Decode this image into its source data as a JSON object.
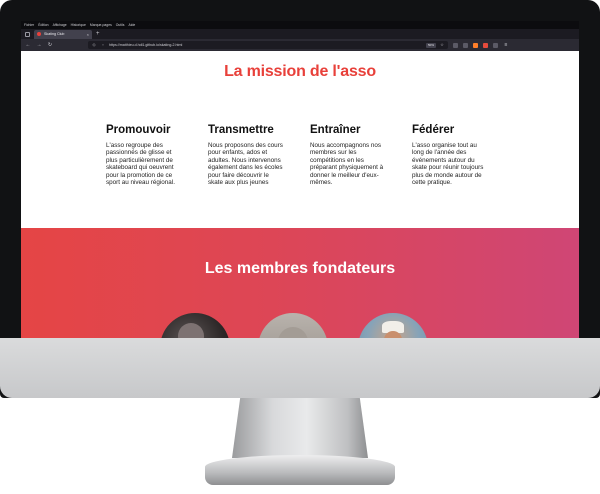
{
  "browser": {
    "menu": [
      "Fichier",
      "Édition",
      "Affichage",
      "Historique",
      "Marque-pages",
      "Outils",
      "Aide"
    ],
    "tab_title": "Skating Club",
    "tab_close": "×",
    "new_tab": "+",
    "url": "https://matthieu.d.hdi1.github.io/skating-2.html",
    "url_badge": "50%"
  },
  "mission": {
    "title": "La mission de l'asso",
    "items": [
      {
        "heading": "Promouvoir",
        "text": "L'asso regroupe des passionnés de glisse et plus particulièrement de skateboard qui oeuvrent pour la promotion de ce sport au niveau régional."
      },
      {
        "heading": "Transmettre",
        "text": "Nous proposons des cours pour enfants, ados et adultes. Nous intervenons également dans les écoles pour faire découvrir le skate aux plus jeunes"
      },
      {
        "heading": "Entraîner",
        "text": "Nous accompagnons nos membres sur les compétitions en les préparant physiquement à donner le meilleur d'eux-mêmes."
      },
      {
        "heading": "Fédérer",
        "text": "L'asso organise tout au long de l'année des événements autour du skate pour réunir toujours plus de monde autour de cette pratique."
      }
    ]
  },
  "founders": {
    "title": "Les membres fondateurs"
  },
  "colors": {
    "accent": "#e8403a",
    "gradient_start": "#e54545",
    "gradient_end": "#cf4675"
  },
  "icons": [
    "tab-list-icon",
    "back-icon",
    "forward-icon",
    "reload-icon",
    "shield-icon",
    "lock-icon",
    "bookmark-icon",
    "download-icon",
    "extensions-icon",
    "menu-icon"
  ]
}
